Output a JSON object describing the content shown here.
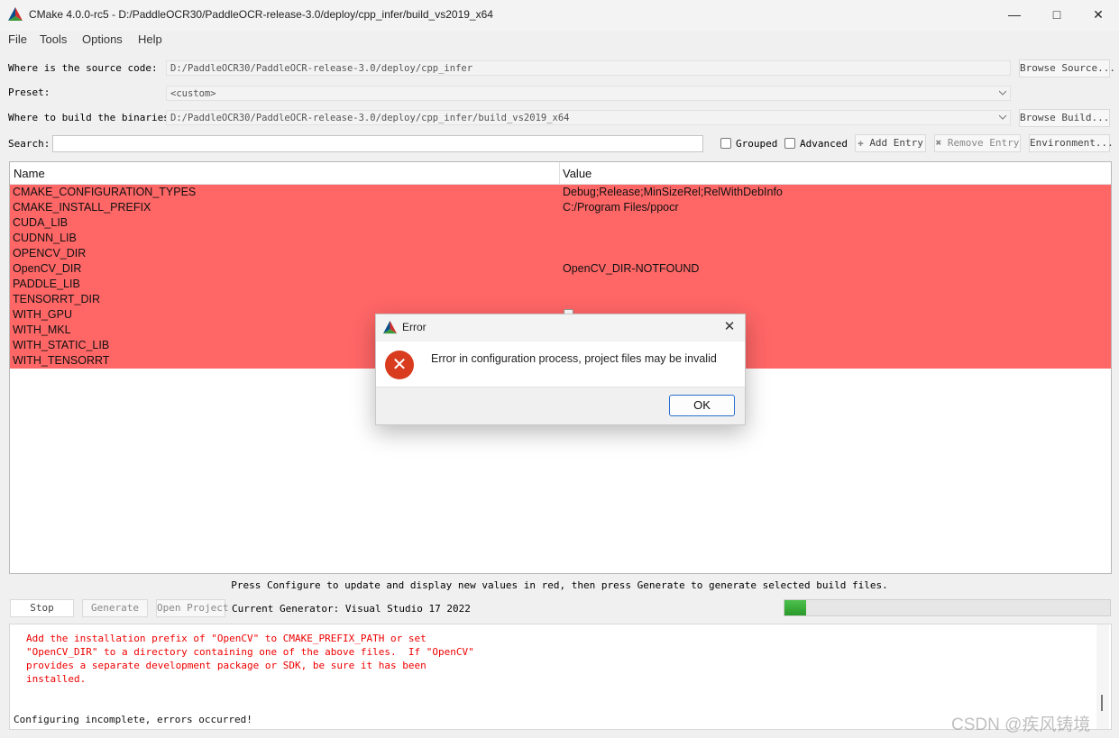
{
  "window": {
    "title": "CMake 4.0.0-rc5 - D:/PaddleOCR30/PaddleOCR-release-3.0/deploy/cpp_infer/build_vs2019_x64"
  },
  "menu": [
    "File",
    "Tools",
    "Options",
    "Help"
  ],
  "source": {
    "label": "Where is the source code:",
    "value": "D:/PaddleOCR30/PaddleOCR-release-3.0/deploy/cpp_infer",
    "button": "Browse Source..."
  },
  "preset": {
    "label": "Preset:",
    "value": "<custom>"
  },
  "build": {
    "label": "Where to build the binaries:",
    "value": "D:/PaddleOCR30/PaddleOCR-release-3.0/deploy/cpp_infer/build_vs2019_x64",
    "button": "Browse Build..."
  },
  "search": {
    "label": "Search:",
    "value": ""
  },
  "options": {
    "grouped": "Grouped",
    "advanced": "Advanced",
    "add_entry": "Add Entry",
    "remove_entry": "Remove Entry",
    "environment": "Environment..."
  },
  "table": {
    "headers": [
      "Name",
      "Value"
    ],
    "row_color": "#ff6666",
    "rows": [
      {
        "name": "CMAKE_CONFIGURATION_TYPES",
        "value": "Debug;Release;MinSizeRel;RelWithDebInfo"
      },
      {
        "name": "CMAKE_INSTALL_PREFIX",
        "value": "C:/Program Files/ppocr"
      },
      {
        "name": "CUDA_LIB",
        "value": ""
      },
      {
        "name": "CUDNN_LIB",
        "value": ""
      },
      {
        "name": "OPENCV_DIR",
        "value": ""
      },
      {
        "name": "OpenCV_DIR",
        "value": "OpenCV_DIR-NOTFOUND"
      },
      {
        "name": "PADDLE_LIB",
        "value": ""
      },
      {
        "name": "TENSORRT_DIR",
        "value": ""
      },
      {
        "name": "WITH_GPU",
        "value": "",
        "checkbox": true
      },
      {
        "name": "WITH_MKL",
        "value": ""
      },
      {
        "name": "WITH_STATIC_LIB",
        "value": ""
      },
      {
        "name": "WITH_TENSORRT",
        "value": ""
      }
    ]
  },
  "hint": "Press Configure to update and display new values in red, then press Generate to generate selected build files.",
  "controls": {
    "stop": "Stop",
    "generate": "Generate",
    "open_project": "Open Project",
    "generator": "Current Generator: Visual Studio 17 2022"
  },
  "progress": 0.066,
  "output": {
    "error_text": "Add the installation prefix of \"OpenCV\" to CMAKE_PREFIX_PATH or set\n\"OpenCV_DIR\" to a directory containing one of the above files.  If \"OpenCV\"\nprovides a separate development package or SDK, be sure it has been\ninstalled.",
    "status": "Configuring incomplete, errors occurred!"
  },
  "dialog": {
    "title": "Error",
    "message": "Error in configuration process, project files may be invalid",
    "ok": "OK"
  },
  "watermark": "CSDN @疾风铸境",
  "icons": [
    "cmake-logo-icon",
    "minimize-icon",
    "maximize-icon",
    "close-icon",
    "chevron-down-icon",
    "add-icon",
    "remove-icon",
    "error-icon"
  ]
}
